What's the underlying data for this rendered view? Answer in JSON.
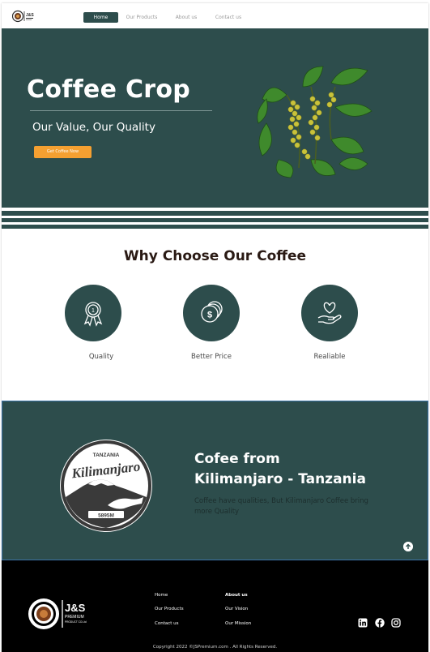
{
  "brand": {
    "logo_text": "J&S",
    "logo_subtext": "PREMIUM",
    "logo_small": "PRODUCT CO.Ltd"
  },
  "nav": {
    "items": [
      {
        "label": "Home"
      },
      {
        "label": "Our Products"
      },
      {
        "label": "About us"
      },
      {
        "label": "Contact us"
      }
    ]
  },
  "hero": {
    "title": "Coffee Crop",
    "subtitle": "Our Value, Our Quality",
    "cta_label": "Get Coffee Now"
  },
  "why": {
    "title": "Why Choose Our Coffee",
    "features": [
      {
        "label": "Quality",
        "icon": "award-ribbon-icon"
      },
      {
        "label": "Better Price",
        "icon": "coins-icon"
      },
      {
        "label": "Realiable",
        "icon": "heart-hand-icon"
      }
    ]
  },
  "kilimanjaro": {
    "badge_top": "TANZANIA",
    "badge_name": "Kilimanjaro",
    "badge_elevation": "5895M",
    "title_line1": "Cofee from",
    "title_line2": "Kilimanjaro - Tanzania",
    "text": "Coffee have qualities, But Kilimanjaro Coffee bring more Quality"
  },
  "footer": {
    "links_col1": [
      "Home",
      "Our Products",
      "Contact us"
    ],
    "links_col2": [
      "About us",
      "Our Vision",
      "Our Mission"
    ],
    "social": [
      "linkedin-icon",
      "facebook-icon",
      "instagram-icon"
    ],
    "copyright": "Copyright 2022 ©JSPremium.com . All Rights Reserved."
  },
  "colors": {
    "primary": "#2d4d4c",
    "accent": "#f5a031",
    "footer": "#000000"
  }
}
